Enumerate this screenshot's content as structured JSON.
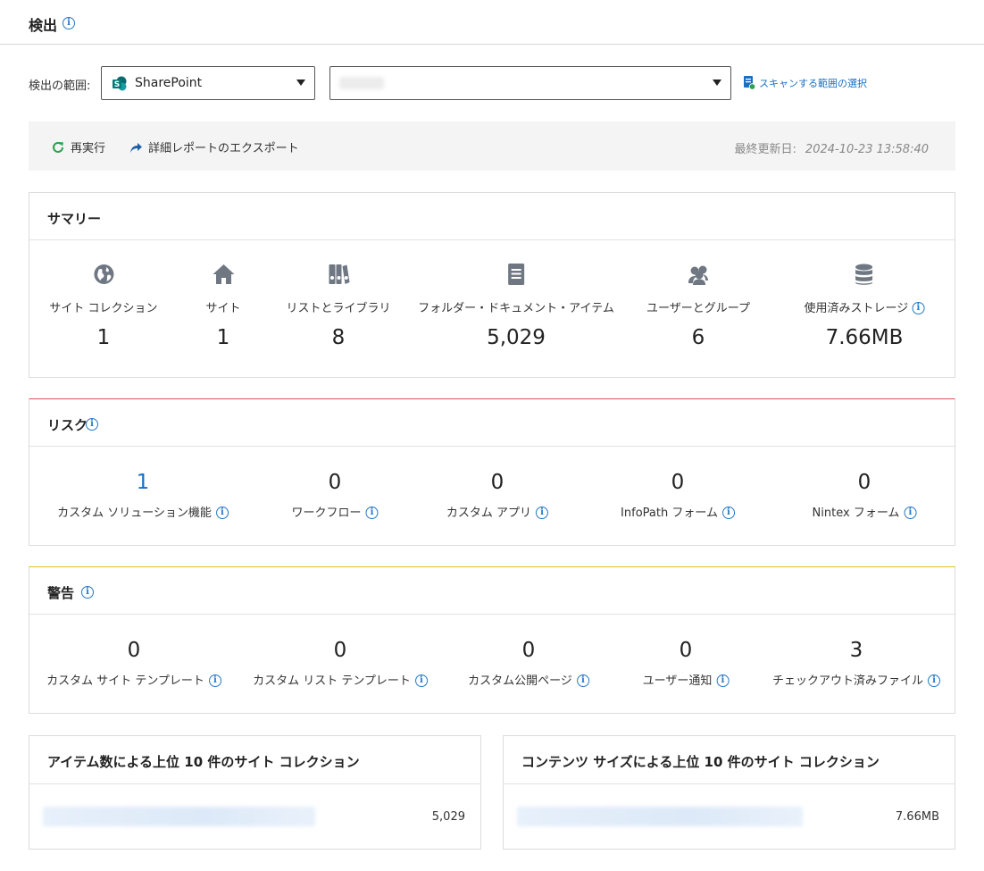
{
  "header": {
    "title": "検出"
  },
  "scope": {
    "label": "検出の範囲:",
    "source_select": "SharePoint",
    "scan_link": "スキャンする範囲の選択"
  },
  "toolbar": {
    "rerun": "再実行",
    "export": "詳細レポートのエクスポート",
    "last_updated_label": "最終更新日:",
    "last_updated_value": "2024-10-23 13:58:40"
  },
  "summary": {
    "title": "サマリー",
    "items": [
      {
        "icon": "globe-icon",
        "label": "サイト コレクション",
        "value": "1"
      },
      {
        "icon": "home-icon",
        "label": "サイト",
        "value": "1"
      },
      {
        "icon": "books-icon",
        "label": "リストとライブラリ",
        "value": "8"
      },
      {
        "icon": "document-icon",
        "label": "フォルダー・ドキュメント・アイテム",
        "value": "5,029"
      },
      {
        "icon": "users-icon",
        "label": "ユーザーとグループ",
        "value": "6"
      },
      {
        "icon": "database-icon",
        "label": "使用済みストレージ",
        "value": "7.66MB"
      }
    ]
  },
  "risk": {
    "title": "リスク",
    "items": [
      {
        "label": "カスタム ソリューション機能",
        "value": "1"
      },
      {
        "label": "ワークフロー",
        "value": "0"
      },
      {
        "label": "カスタム アプリ",
        "value": "0"
      },
      {
        "label": "InfoPath フォーム",
        "value": "0"
      },
      {
        "label": "Nintex フォーム",
        "value": "0"
      }
    ]
  },
  "warning": {
    "title": "警告",
    "items": [
      {
        "label": "カスタム サイト テンプレート",
        "value": "0"
      },
      {
        "label": "カスタム リスト テンプレート",
        "value": "0"
      },
      {
        "label": "カスタム公開ページ",
        "value": "0"
      },
      {
        "label": "ユーザー通知",
        "value": "0"
      },
      {
        "label": "チェックアウト済みファイル",
        "value": "3"
      }
    ]
  },
  "top_by_items": {
    "title": "アイテム数による上位 10 件のサイト コレクション",
    "value": "5,029"
  },
  "top_by_size": {
    "title": "コンテンツ サイズによる上位 10 件のサイト コレクション",
    "value": "7.66MB"
  },
  "colors": {
    "accent": "#1a6fc0",
    "risk_border": "#d9534f",
    "warning_border": "#e0c01a",
    "rerun_icon": "#2e9e4f"
  }
}
